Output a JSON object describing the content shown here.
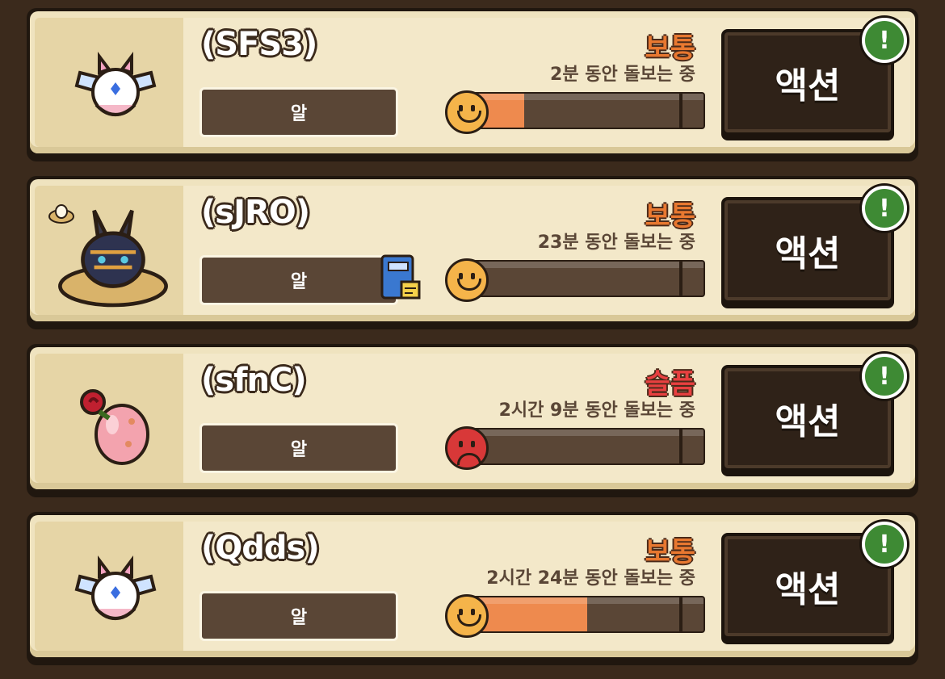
{
  "pets": [
    {
      "name": "(SFS3)",
      "type": "알",
      "mood": "보통",
      "care": "2분 동안 돌보는 중",
      "progress": 0.26,
      "mood_kind": "neutral",
      "action": "액션",
      "alert": "!",
      "creature": "winged-spirit-icon"
    },
    {
      "name": "(sJRO)",
      "type": "알",
      "mood": "보통",
      "care": "23분 동안 돌보는 중",
      "progress": 0.04,
      "mood_kind": "neutral",
      "action": "액션",
      "alert": "!",
      "creature": "horned-beetle-nest-icon",
      "badge": "nest-egg-icon",
      "note": "journal-book-icon"
    },
    {
      "name": "(sfnC)",
      "type": "알",
      "mood": "슬픔",
      "care": "2시간 9분 동안 돌보는 중",
      "progress": 0.0,
      "mood_kind": "sad",
      "action": "액션",
      "alert": "!",
      "creature": "pink-egg-rose-icon"
    },
    {
      "name": "(Qdds)",
      "type": "알",
      "mood": "보통",
      "care": "2시간 24분 동안 돌보는 중",
      "progress": 0.52,
      "mood_kind": "neutral",
      "action": "액션",
      "alert": "!",
      "creature": "winged-spirit-icon"
    }
  ],
  "colors": {
    "background": "#3b2a1c",
    "card": "#efe3bf",
    "progress": "#ee8a4e",
    "alert": "#3e8a34",
    "mood_neutral": "#e87830",
    "mood_sad": "#e84040"
  }
}
